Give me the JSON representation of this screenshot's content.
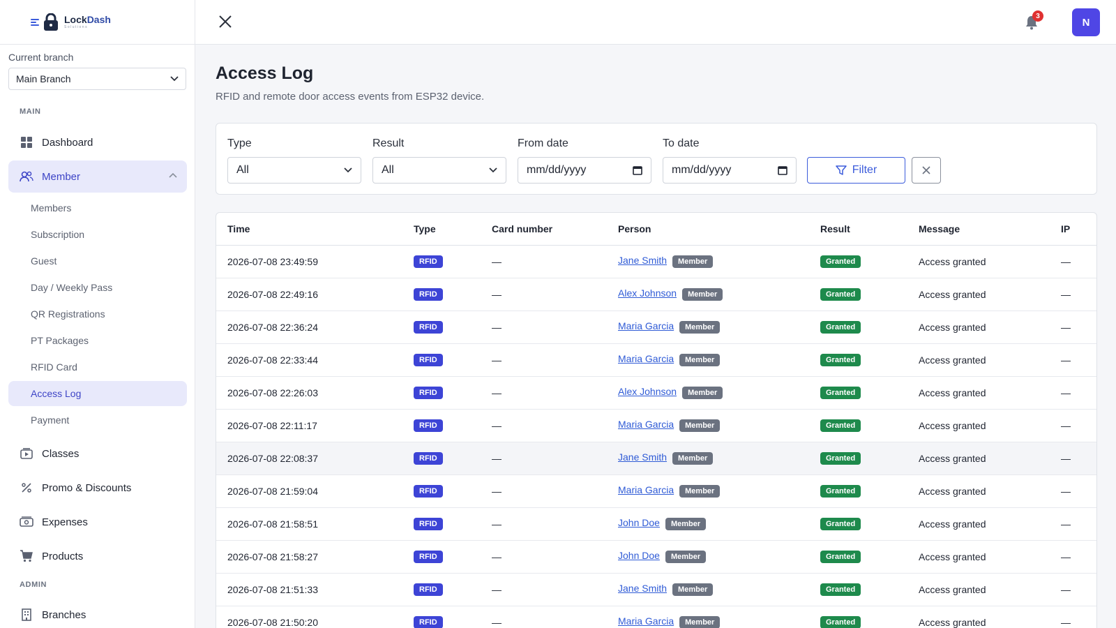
{
  "brand": {
    "name_part1": "Lock",
    "name_part2": "Dash",
    "subtitle": "Solutions"
  },
  "branch": {
    "label": "Current branch",
    "selected": "Main Branch"
  },
  "sidebar": {
    "main_title": "MAIN",
    "admin_title": "ADMIN",
    "dashboard": "Dashboard",
    "member": "Member",
    "sub_items": [
      "Members",
      "Subscription",
      "Guest",
      "Day / Weekly Pass",
      "QR Registrations",
      "PT Packages",
      "RFID Card",
      "Access Log",
      "Payment"
    ],
    "classes": "Classes",
    "promo": "Promo & Discounts",
    "expenses": "Expenses",
    "products": "Products",
    "branches": "Branches"
  },
  "topbar": {
    "notification_count": "3",
    "avatar_initial": "N"
  },
  "page": {
    "title": "Access Log",
    "subtitle": "RFID and remote door access events from ESP32 device."
  },
  "filters": {
    "type_label": "Type",
    "type_value": "All",
    "result_label": "Result",
    "result_value": "All",
    "from_label": "From date",
    "from_placeholder": "mm/dd/yyyy",
    "to_label": "To date",
    "to_placeholder": "mm/dd/yyyy",
    "filter_button": "Filter"
  },
  "table": {
    "headers": {
      "time": "Time",
      "type": "Type",
      "card": "Card number",
      "person": "Person",
      "result": "Result",
      "message": "Message",
      "ip": "IP"
    },
    "rows": [
      {
        "time": "2026-07-08 23:49:59",
        "type": "RFID",
        "card": "—",
        "person": "Jane Smith",
        "role": "Member",
        "result": "Granted",
        "message": "Access granted",
        "ip": "—"
      },
      {
        "time": "2026-07-08 22:49:16",
        "type": "RFID",
        "card": "—",
        "person": "Alex Johnson",
        "role": "Member",
        "result": "Granted",
        "message": "Access granted",
        "ip": "—"
      },
      {
        "time": "2026-07-08 22:36:24",
        "type": "RFID",
        "card": "—",
        "person": "Maria Garcia",
        "role": "Member",
        "result": "Granted",
        "message": "Access granted",
        "ip": "—"
      },
      {
        "time": "2026-07-08 22:33:44",
        "type": "RFID",
        "card": "—",
        "person": "Maria Garcia",
        "role": "Member",
        "result": "Granted",
        "message": "Access granted",
        "ip": "—"
      },
      {
        "time": "2026-07-08 22:26:03",
        "type": "RFID",
        "card": "—",
        "person": "Alex Johnson",
        "role": "Member",
        "result": "Granted",
        "message": "Access granted",
        "ip": "—"
      },
      {
        "time": "2026-07-08 22:11:17",
        "type": "RFID",
        "card": "—",
        "person": "Maria Garcia",
        "role": "Member",
        "result": "Granted",
        "message": "Access granted",
        "ip": "—"
      },
      {
        "time": "2026-07-08 22:08:37",
        "type": "RFID",
        "card": "—",
        "person": "Jane Smith",
        "role": "Member",
        "result": "Granted",
        "message": "Access granted",
        "ip": "—"
      },
      {
        "time": "2026-07-08 21:59:04",
        "type": "RFID",
        "card": "—",
        "person": "Maria Garcia",
        "role": "Member",
        "result": "Granted",
        "message": "Access granted",
        "ip": "—"
      },
      {
        "time": "2026-07-08 21:58:51",
        "type": "RFID",
        "card": "—",
        "person": "John Doe",
        "role": "Member",
        "result": "Granted",
        "message": "Access granted",
        "ip": "—"
      },
      {
        "time": "2026-07-08 21:58:27",
        "type": "RFID",
        "card": "—",
        "person": "John Doe",
        "role": "Member",
        "result": "Granted",
        "message": "Access granted",
        "ip": "—"
      },
      {
        "time": "2026-07-08 21:51:33",
        "type": "RFID",
        "card": "—",
        "person": "Jane Smith",
        "role": "Member",
        "result": "Granted",
        "message": "Access granted",
        "ip": "—"
      },
      {
        "time": "2026-07-08 21:50:20",
        "type": "RFID",
        "card": "—",
        "person": "Maria Garcia",
        "role": "Member",
        "result": "Granted",
        "message": "Access granted",
        "ip": "—"
      }
    ]
  },
  "colors": {
    "accent": "#4f46e5",
    "active_bg": "#e8e9fb",
    "granted": "#1e8a4c",
    "rfid": "#3d44d6",
    "member": "#6b7280",
    "link": "#2f5bd6"
  }
}
